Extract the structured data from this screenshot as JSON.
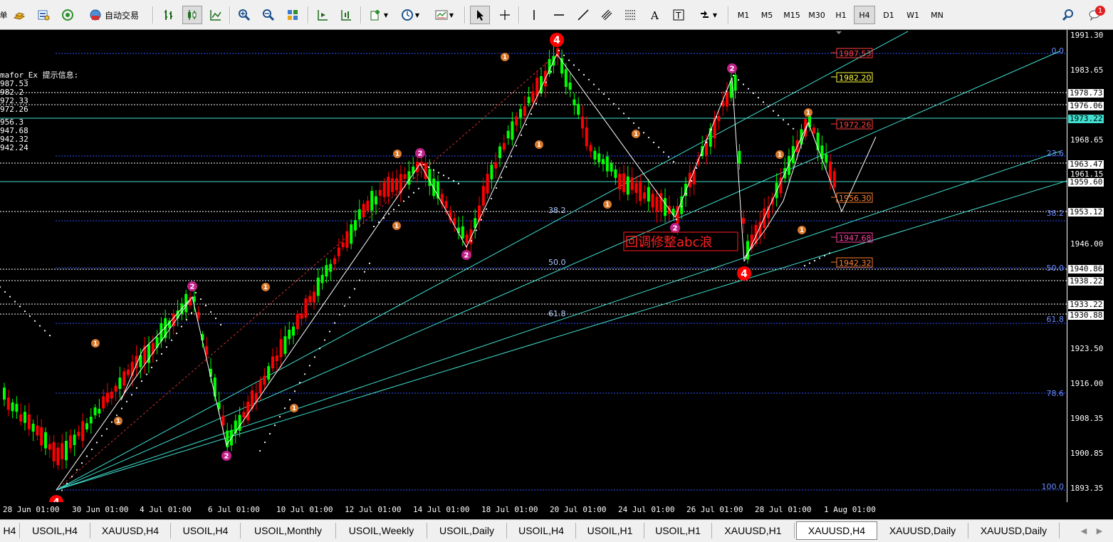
{
  "toolbar": {
    "auto_trade_label": "自动交易",
    "periods": [
      "M1",
      "M5",
      "M15",
      "M30",
      "H1",
      "H4",
      "D1",
      "W1",
      "MN"
    ],
    "active_period": "H4",
    "notification_count": "1"
  },
  "chart": {
    "indicator_header": "mafor_Ex 提示信息:",
    "indicator_values": [
      "987.53",
      "982.2",
      "972.33",
      "972.26",
      "",
      "956.3",
      "947.68",
      "942.32",
      "942.24"
    ],
    "annotation": "回调修整abc浪",
    "fib_labels_mid": [
      "38.2",
      "50.0",
      "61.8"
    ],
    "fib_labels_right": [
      "0.0",
      "23.6",
      "38.2",
      "50.0",
      "61.8",
      "78.6",
      "100.0"
    ],
    "level_tags": [
      "1987.53",
      "1982.20",
      "1972.26",
      "1956.30",
      "1947.68",
      "1942.32"
    ],
    "wave_labels": {
      "four": "4",
      "two": "2",
      "one": "1"
    },
    "colors": {
      "bull_candle": "#00ff00",
      "bear_candle": "#ff0000",
      "fib_line": "#3050ff",
      "channel": "#40e0d0",
      "wave_line": "#ffffff",
      "wave_four": "#ff0000",
      "wave_two": "#c0208a",
      "wave_one": "#d8782a",
      "annotation": "#ff2020"
    }
  },
  "price_axis": {
    "labels": [
      "1991.30",
      "1983.65",
      "1978.73",
      "1976.06",
      "1973.22",
      "1968.65",
      "1963.47",
      "1961.15",
      "1959.60",
      "1953.12",
      "1946.00",
      "1940.86",
      "1938.22",
      "1933.22",
      "1930.88",
      "1923.50",
      "1916.00",
      "1908.35",
      "1900.85",
      "1893.35"
    ],
    "current_price": "1973.22"
  },
  "time_axis": {
    "labels": [
      "28 Jun 01:00",
      "30 Jun 01:00",
      "4 Jul 01:00",
      "6 Jul 01:00",
      "10 Jul 01:00",
      "12 Jul 01:00",
      "14 Jul 01:00",
      "18 Jul 01:00",
      "20 Jul 01:00",
      "24 Jul 01:00",
      "26 Jul 01:00",
      "28 Jul 01:00",
      "1 Aug 01:00"
    ]
  },
  "tabs": [
    "H4",
    "USOIL,H4",
    "XAUUSD,H4",
    "USOIL,H4",
    "USOIL,Monthly",
    "USOIL,Weekly",
    "USOIL,Daily",
    "USOIL,H4",
    "USOIL,H1",
    "USOIL,H1",
    "XAUUSD,H1",
    "XAUUSD,H4",
    "XAUUSD,Daily",
    "XAUUSD,Daily"
  ],
  "active_tab_index": 11
}
